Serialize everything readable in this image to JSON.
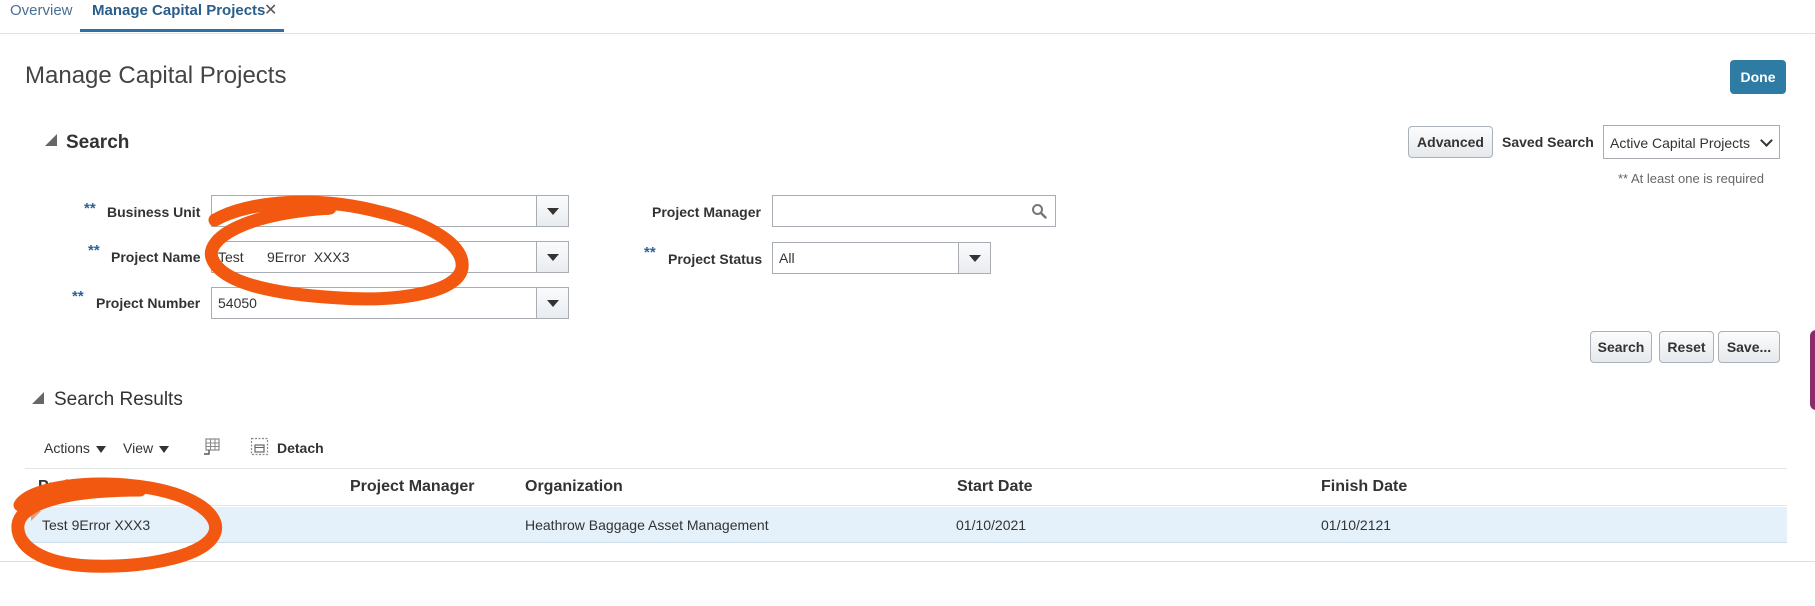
{
  "tabs": [
    {
      "label": "Overview"
    },
    {
      "label": "Manage Capital Projects",
      "close": "✕"
    }
  ],
  "page": {
    "title": "Manage Capital Projects",
    "done_label": "Done"
  },
  "search": {
    "header": "Search",
    "advanced_label": "Advanced",
    "saved_search_label": "Saved Search",
    "saved_search_value": "Active Capital Projects",
    "required_note": "** At least one is required",
    "required_marker": "**",
    "fields": {
      "business_unit": {
        "label": "Business Unit",
        "value": ""
      },
      "project_name": {
        "label": "Project Name",
        "value": "Test      9Error  XXX3"
      },
      "project_number": {
        "label": "Project Number",
        "value": "54050"
      },
      "project_manager": {
        "label": "Project Manager",
        "value": ""
      },
      "project_status": {
        "label": "Project Status",
        "value": "All"
      }
    },
    "buttons": {
      "search": "Search",
      "reset": "Reset",
      "save": "Save..."
    }
  },
  "results": {
    "header": "Search Results",
    "toolbar": {
      "actions": "Actions",
      "view": "View",
      "detach": "Detach"
    },
    "columns": [
      "Project Name",
      "Project Manager",
      "Organization",
      "Start Date",
      "Finish Date"
    ],
    "rows": [
      {
        "project_name": "Test 9Error XXX3",
        "project_manager": "",
        "organization": "Heathrow Baggage Asset Management",
        "start_date": "01/10/2021",
        "finish_date": "01/10/2121"
      }
    ]
  },
  "colors": {
    "accent": "#2e7ba3",
    "annotation": "#f2580f",
    "row_highlight": "#e4f0fa"
  }
}
